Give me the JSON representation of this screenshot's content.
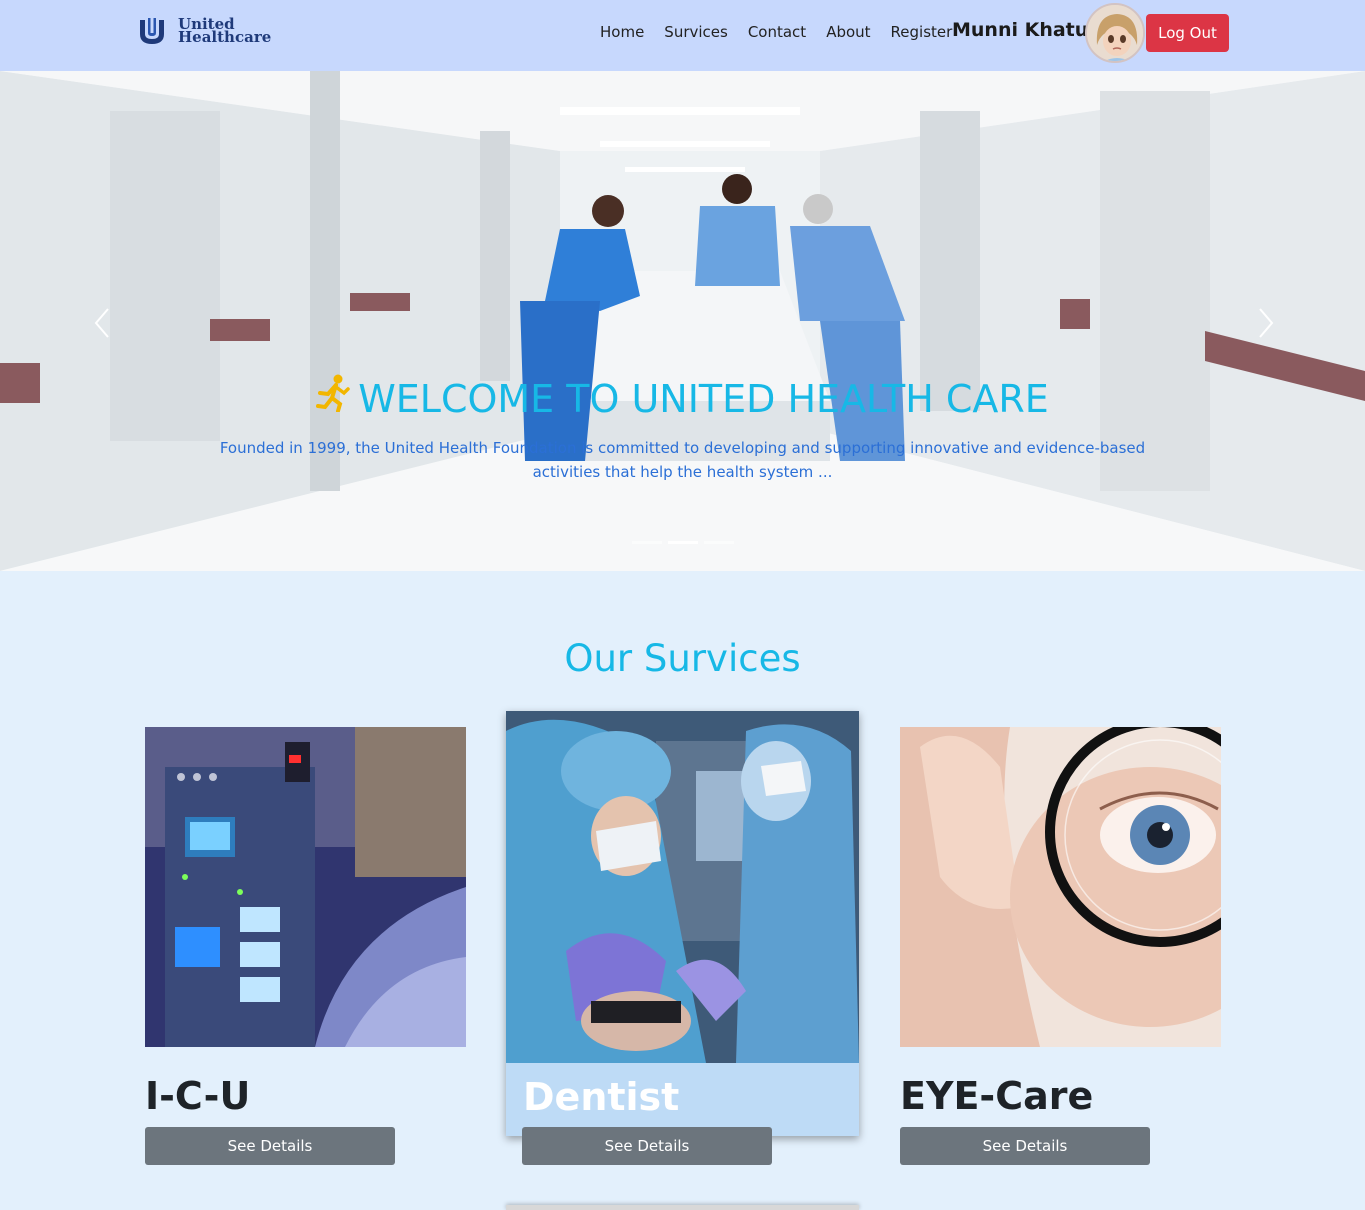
{
  "brand": {
    "line1": "United",
    "line2": "Healthcare"
  },
  "nav": {
    "items": [
      {
        "label": "Home"
      },
      {
        "label": "Survices"
      },
      {
        "label": "Contact"
      },
      {
        "label": "About"
      },
      {
        "label": "Register"
      }
    ]
  },
  "user": {
    "name": "Munni Khatun",
    "logout_label": "Log Out"
  },
  "colors": {
    "nav_bg": "#c7d8fd",
    "accent": "#17b8e6",
    "danger": "#dc3545",
    "secondary": "#6c757d",
    "page_bg": "#e3f0fc"
  },
  "hero": {
    "title": "WELCOME TO UNITED HEALTH CARE",
    "title_icon": "runner-icon",
    "text": "Founded in 1999, the United Health Foundation is committed to developing and supporting innovative and evidence-based activities that help the health system ...",
    "active_slide": 2,
    "slide_count": 3
  },
  "services": {
    "title": "Our Survices",
    "cards": [
      {
        "title": "I-C-U",
        "button": "See Details",
        "image": "icu-equipment-image"
      },
      {
        "title": "Dentist",
        "button": "See Details",
        "image": "dentist-surgery-image"
      },
      {
        "title": "EYE-Care",
        "button": "See Details",
        "image": "eye-glasses-image"
      }
    ]
  }
}
